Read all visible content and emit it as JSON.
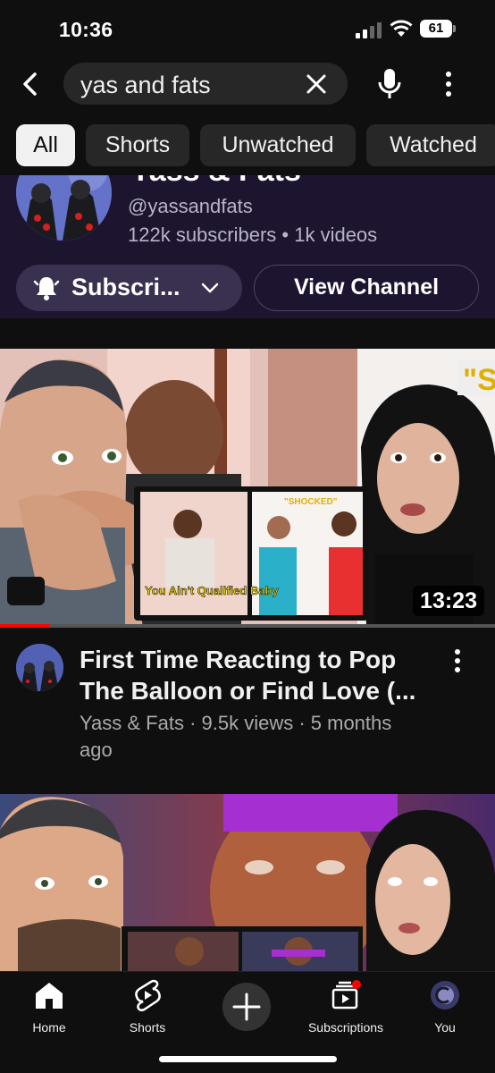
{
  "status_bar": {
    "time": "10:36",
    "battery": "61"
  },
  "search": {
    "query": "yas and fats"
  },
  "chips": [
    {
      "label": "All",
      "active": true
    },
    {
      "label": "Shorts",
      "active": false
    },
    {
      "label": "Unwatched",
      "active": false
    },
    {
      "label": "Watched",
      "active": false
    }
  ],
  "channel": {
    "name": "Yass & Fats",
    "handle": "@yassandfats",
    "stats": "122k subscribers • 1k videos",
    "subscribe_label": "Subscri...",
    "view_channel_label": "View Channel",
    "card_color": "#1d1530"
  },
  "videos": [
    {
      "title": "First Time Reacting to Pop The Balloon or Find Love (...",
      "subtitle": "Yass & Fats · 9.5k views · 5 months ago",
      "duration": "13:23",
      "watched_fraction": 0.1,
      "thumb_captions": {
        "top_right": "\"S",
        "inset_left": "You Ain't Qualified Baby",
        "inset_right": "\"SHOCKED\""
      }
    }
  ],
  "nav": [
    {
      "label": "Home",
      "icon": "home-icon"
    },
    {
      "label": "Shorts",
      "icon": "shorts-icon"
    },
    {
      "label": "",
      "icon": "plus-icon"
    },
    {
      "label": "Subscriptions",
      "icon": "subscriptions-icon"
    },
    {
      "label": "You",
      "icon": "avatar-icon"
    }
  ],
  "colors": {
    "background": "#0f0f0f",
    "accent_red": "#ff0000",
    "chip": "#272727"
  }
}
